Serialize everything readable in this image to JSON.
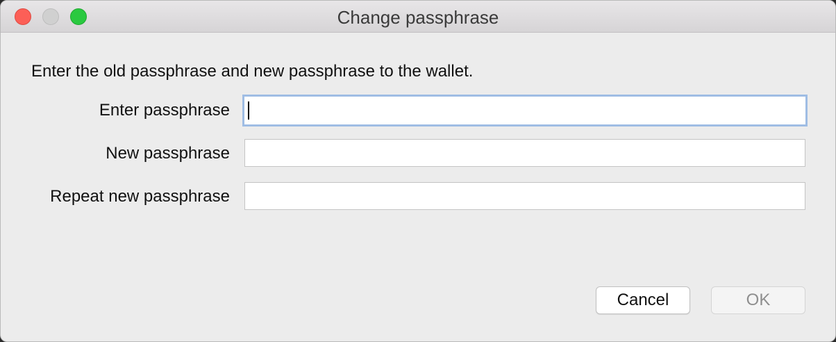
{
  "window": {
    "title": "Change passphrase"
  },
  "form": {
    "intro": "Enter the old passphrase and new passphrase to the wallet.",
    "fields": [
      {
        "label": "Enter passphrase",
        "value": ""
      },
      {
        "label": "New passphrase",
        "value": ""
      },
      {
        "label": "Repeat new passphrase",
        "value": ""
      }
    ]
  },
  "buttons": {
    "cancel": "Cancel",
    "ok": "OK"
  },
  "colors": {
    "close": "#fc5f57",
    "minimize": "#d0d0d0",
    "zoom": "#2ac940",
    "focus_ring": "#9fbde4"
  }
}
